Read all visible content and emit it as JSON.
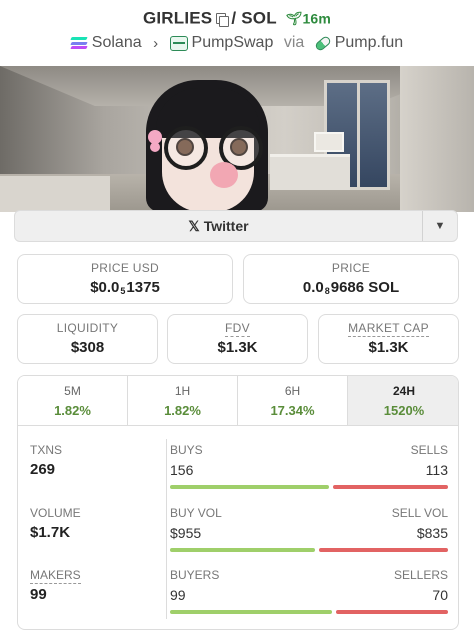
{
  "header": {
    "token": "GIRLIES",
    "separator": "/",
    "quote": "SOL",
    "age": "16m",
    "chain": "Solana",
    "dex": "PumpSwap",
    "via": "via",
    "launchpad": "Pump.fun"
  },
  "links": {
    "twitter_label": "Twitter"
  },
  "prices": {
    "price_usd_label": "PRICE USD",
    "price_usd_prefix": "$0.0",
    "price_usd_zeros": "5",
    "price_usd_digits": "1375",
    "price_label": "PRICE",
    "price_prefix": "0.0",
    "price_zeros": "8",
    "price_digits": "9686 SOL"
  },
  "stats": {
    "liquidity_label": "LIQUIDITY",
    "liquidity": "$308",
    "fdv_label": "FDV",
    "fdv": "$1.3K",
    "mcap_label": "MARKET CAP",
    "mcap": "$1.3K"
  },
  "timeframes": [
    {
      "label": "5M",
      "change": "1.82%"
    },
    {
      "label": "1H",
      "change": "1.82%"
    },
    {
      "label": "6H",
      "change": "17.34%"
    },
    {
      "label": "24H",
      "change": "1520%"
    }
  ],
  "txns": {
    "txns_label": "TXNS",
    "txns": "269",
    "buys_label": "BUYS",
    "buys": "156",
    "sells_label": "SELLS",
    "sells": "113",
    "buys_share": 0.58,
    "volume_label": "VOLUME",
    "volume": "$1.7K",
    "buy_vol_label": "BUY VOL",
    "buy_vol": "$955",
    "sell_vol_label": "SELL VOL",
    "sell_vol": "$835",
    "buy_vol_share": 0.53,
    "makers_label": "MAKERS",
    "makers": "99",
    "buyers_label": "BUYERS",
    "buyers": "99",
    "sellers_label": "SELLERS",
    "sellers": "70",
    "buyers_share": 0.59
  },
  "colors": {
    "positive": "#5a8d3a",
    "buy_bar": "#9fcf6a",
    "sell_bar": "#e26363"
  }
}
